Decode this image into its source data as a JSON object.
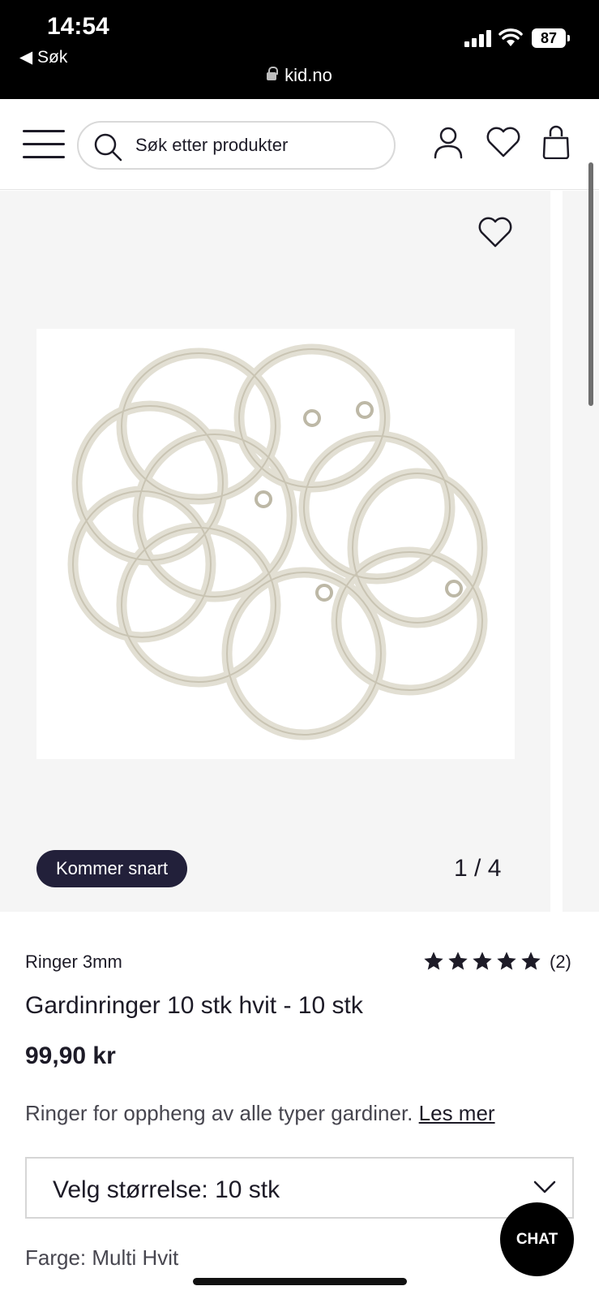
{
  "status_bar": {
    "time": "14:54",
    "back_label": "◀ Søk",
    "url": "kid.no",
    "battery": "87"
  },
  "header": {
    "search_placeholder": "Søk etter produkter",
    "icons": [
      "menu-icon",
      "search-icon",
      "user-icon",
      "heart-icon",
      "bag-icon"
    ]
  },
  "gallery": {
    "badge": "Kommer snart",
    "counter": "1 / 4",
    "image_alt": "Gardinringer hvit"
  },
  "product": {
    "subtitle": "Ringer 3mm",
    "rating": 5,
    "reviews": "(2)",
    "title": "Gardinringer 10 stk hvit - 10 stk",
    "price": "99,90 kr",
    "description": "Ringer for oppheng av alle typer gardiner.",
    "read_more": "Les mer",
    "size_select": "Velg størrelse: 10 stk",
    "color_label": "Farge:",
    "color_value": "Multi Hvit"
  },
  "chat": {
    "label": "CHAT"
  },
  "colors": {
    "dark": "#1d1b27",
    "badge_bg": "#22203a",
    "gallery_bg": "#f5f5f5"
  }
}
